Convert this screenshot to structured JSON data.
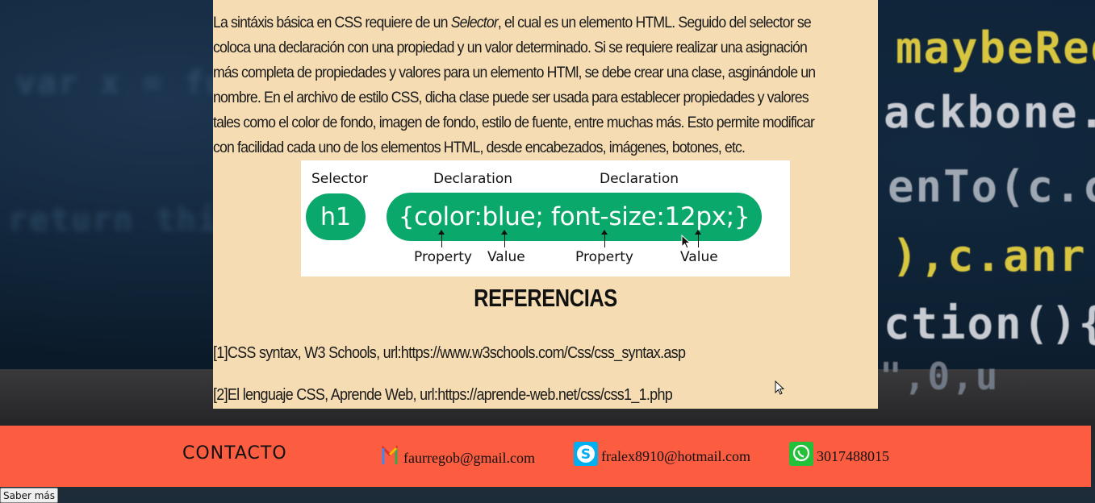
{
  "intro": {
    "before_em": "La sintáxis básica en CSS requiere de un ",
    "em": "Selector",
    "after_em": ", el cual es un elemento HTML. Seguido del selector se coloca una declaración con una propiedad y un valor determinado. Si se requiere realizar una asignación más completa de propiedades y valores para un elemento HTMl, se debe crear una clase, asginándole un nombre. En el archivo de estilo CSS, dicha clase puede ser usada para establecer propiedades y valores tales como el color de fondo, imagen de fondo, estilo de fuente, entre muchas más. Esto permite modificar con facilidad cada uno de los elementos HTML, desde encabezados, imágenes, botones, etc."
  },
  "diagram": {
    "selector_label": "Selector",
    "declaration_label_1": "Declaration",
    "declaration_label_2": "Declaration",
    "selector_code": "h1",
    "declaration_code": "{color:blue; font-size:12px;}",
    "property_label_1": "Property",
    "value_label_1": "Value",
    "property_label_2": "Property",
    "value_label_2": "Value"
  },
  "references": {
    "title": "REFERENCIAS",
    "items": [
      "[1]CSS syntax, W3 Schools, url:https://www.w3schools.com/Css/css_syntax.asp",
      "[2]El lenguaje CSS, Aprende Web, url:https://aprende-web.net/css/css1_1.php"
    ]
  },
  "footer": {
    "contact_label": "CONTACTO",
    "gmail": "faurregob@gmail.com",
    "skype": "fralex8910@hotmail.com",
    "whatsapp": "3017488015"
  },
  "saber_mas": "Saber más",
  "background_code": {
    "line1": "maybeReq",
    "line2": "ackbone.V",
    "line3": "enTo(c.co",
    "line4": "),c.anr",
    "line5": "ction(){(",
    "line6": "\",0,u"
  },
  "colors": {
    "panel": "#f5dcb3",
    "footer": "#fc5c3f",
    "pill_green": "#0aa86a"
  },
  "icons": [
    "gmail-icon",
    "skype-icon",
    "whatsapp-icon",
    "mouse-cursor-icon"
  ]
}
